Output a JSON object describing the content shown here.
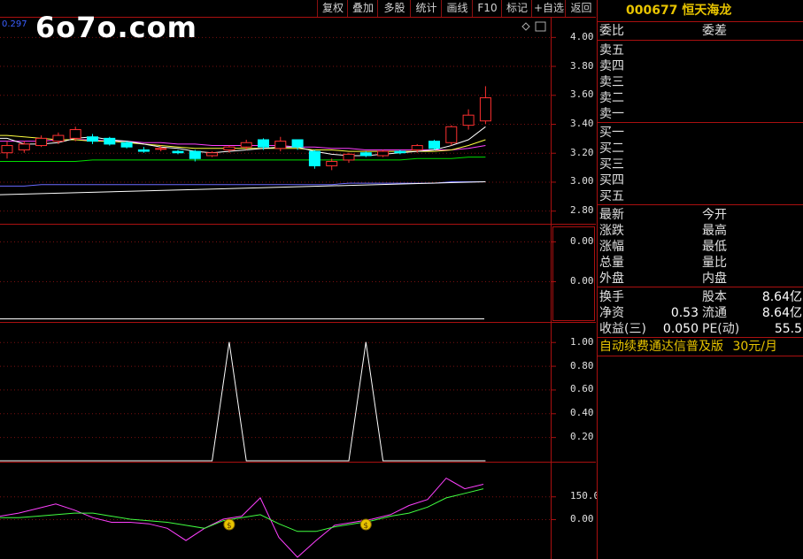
{
  "toolbar": {
    "buttons": [
      "复权",
      "叠加",
      "多股",
      "统计",
      "画线",
      "F10",
      "标记",
      "+自选",
      "返回"
    ]
  },
  "watermark": "6o7o.com",
  "main_value_label": "0.297",
  "stock": {
    "code": "000677",
    "name": "恒天海龙"
  },
  "order_book": {
    "header_left": "委比",
    "header_right": "委差",
    "sell": [
      "卖五",
      "卖四",
      "卖三",
      "卖二",
      "卖一"
    ],
    "buy": [
      "买一",
      "买二",
      "买三",
      "买四",
      "买五"
    ]
  },
  "quote": {
    "left": [
      "最新",
      "涨跌",
      "涨幅",
      "总量",
      "外盘"
    ],
    "right": [
      "今开",
      "最高",
      "最低",
      "量比",
      "内盘"
    ]
  },
  "fundamentals": [
    {
      "label": "换手",
      "value": "",
      "label2": "股本",
      "value2": "8.64亿"
    },
    {
      "label": "净资",
      "value": "0.53",
      "label2": "流通",
      "value2": "8.64亿"
    },
    {
      "label": "收益(三)",
      "value": "0.050",
      "label2": "PE(动)",
      "value2": "55.5"
    }
  ],
  "ad": {
    "text": "自动续费通达信普及版",
    "price": "30元/月"
  },
  "colors": {
    "border": "#aa1010",
    "up": "#ff3030",
    "down": "#00ffff",
    "stock_name": "#e8c400"
  },
  "chart_data": [
    {
      "type": "candlestick",
      "y_ticks": [
        "4.00",
        "3.80",
        "3.60",
        "3.40",
        "3.20",
        "3.00",
        "2.80"
      ],
      "ylim": [
        2.74,
        4.06
      ],
      "candles": [
        [
          3.2,
          3.25,
          3.16,
          3.28
        ],
        [
          3.22,
          3.26,
          3.2,
          3.28
        ],
        [
          3.25,
          3.3,
          3.24,
          3.32
        ],
        [
          3.28,
          3.32,
          3.26,
          3.34
        ],
        [
          3.3,
          3.36,
          3.28,
          3.38
        ],
        [
          3.31,
          3.28,
          3.26,
          3.33
        ],
        [
          3.3,
          3.26,
          3.25,
          3.31
        ],
        [
          3.27,
          3.24,
          3.23,
          3.28
        ],
        [
          3.22,
          3.21,
          3.2,
          3.24
        ],
        [
          3.23,
          3.23,
          3.21,
          3.25
        ],
        [
          3.21,
          3.2,
          3.19,
          3.22
        ],
        [
          3.21,
          3.16,
          3.14,
          3.22
        ],
        [
          3.18,
          3.2,
          3.17,
          3.21
        ],
        [
          3.22,
          3.24,
          3.2,
          3.25
        ],
        [
          3.24,
          3.27,
          3.22,
          3.29
        ],
        [
          3.29,
          3.24,
          3.22,
          3.3
        ],
        [
          3.23,
          3.28,
          3.21,
          3.31
        ],
        [
          3.29,
          3.24,
          3.22,
          3.29
        ],
        [
          3.21,
          3.11,
          3.09,
          3.22
        ],
        [
          3.11,
          3.14,
          3.08,
          3.16
        ],
        [
          3.15,
          3.19,
          3.13,
          3.2
        ],
        [
          3.2,
          3.18,
          3.17,
          3.21
        ],
        [
          3.18,
          3.21,
          3.17,
          3.22
        ],
        [
          3.21,
          3.2,
          3.19,
          3.22
        ],
        [
          3.22,
          3.25,
          3.2,
          3.26
        ],
        [
          3.28,
          3.23,
          3.22,
          3.29
        ],
        [
          3.27,
          3.38,
          3.25,
          3.39
        ],
        [
          3.39,
          3.46,
          3.36,
          3.5
        ],
        [
          3.42,
          3.58,
          3.4,
          3.66
        ]
      ],
      "ma_white": [
        3.3,
        3.26,
        3.26,
        3.27,
        3.3,
        3.31,
        3.29,
        3.28,
        3.26,
        3.24,
        3.23,
        3.21,
        3.2,
        3.21,
        3.22,
        3.23,
        3.24,
        3.24,
        3.21,
        3.19,
        3.18,
        3.18,
        3.19,
        3.2,
        3.21,
        3.22,
        3.25,
        3.29,
        3.38
      ],
      "ma_yellow": [
        3.32,
        3.31,
        3.3,
        3.29,
        3.29,
        3.28,
        3.28,
        3.27,
        3.26,
        3.25,
        3.24,
        3.23,
        3.23,
        3.23,
        3.23,
        3.23,
        3.23,
        3.23,
        3.22,
        3.22,
        3.21,
        3.21,
        3.21,
        3.21,
        3.21,
        3.21,
        3.22,
        3.25,
        3.29
      ],
      "ma_magenta": [
        3.28,
        3.28,
        3.28,
        3.29,
        3.29,
        3.29,
        3.28,
        3.28,
        3.27,
        3.27,
        3.26,
        3.26,
        3.25,
        3.25,
        3.25,
        3.25,
        3.25,
        3.24,
        3.24,
        3.23,
        3.23,
        3.22,
        3.22,
        3.22,
        3.22,
        3.22,
        3.22,
        3.23,
        3.25
      ],
      "ma_green": [
        3.14,
        3.14,
        3.14,
        3.14,
        3.14,
        3.15,
        3.15,
        3.15,
        3.15,
        3.15,
        3.15,
        3.15,
        3.15,
        3.15,
        3.15,
        3.15,
        3.15,
        3.15,
        3.15,
        3.15,
        3.15,
        3.15,
        3.15,
        3.15,
        3.16,
        3.16,
        3.16,
        3.17,
        3.17
      ],
      "ma_blue": [
        2.97,
        2.97,
        2.98,
        2.98,
        2.98,
        2.98,
        2.98,
        2.98,
        2.98,
        2.98,
        2.98,
        2.98,
        2.98,
        2.98,
        2.98,
        2.98,
        2.98,
        2.98,
        2.98,
        2.98,
        2.99,
        2.99,
        2.99,
        2.99,
        2.99,
        2.99,
        3.0,
        3.0,
        3.0
      ]
    },
    {
      "type": "line",
      "y_ticks": [
        "0.00",
        "0.00"
      ],
      "values": [
        0,
        0,
        0,
        0,
        0,
        0,
        0,
        0,
        0,
        0,
        0,
        0,
        0,
        0,
        0,
        0,
        0,
        0,
        0,
        0,
        0,
        0,
        0,
        0,
        0,
        0,
        0,
        0,
        0
      ]
    },
    {
      "type": "line",
      "y_ticks": [
        "1.00",
        "0.80",
        "0.60",
        "0.40",
        "0.20"
      ],
      "ylim": [
        0,
        1.05
      ],
      "values": [
        0,
        0,
        0,
        0,
        0,
        0,
        0,
        0,
        0,
        0,
        0,
        0,
        0,
        1,
        0,
        0,
        0,
        0,
        0,
        0,
        0,
        1,
        0,
        0,
        0,
        0,
        0,
        0,
        0
      ]
    },
    {
      "type": "line",
      "y_ticks": [
        "150.0",
        "0.00"
      ],
      "ylim": [
        -250,
        320
      ],
      "series": [
        {
          "values": [
            20,
            40,
            70,
            100,
            60,
            10,
            -20,
            -20,
            -30,
            -60,
            -140,
            -60,
            0,
            20,
            140,
            -120,
            -250,
            -140,
            -40,
            -20,
            0,
            30,
            90,
            130,
            270,
            200,
            230
          ]
        },
        {
          "values": [
            10,
            10,
            20,
            30,
            40,
            40,
            20,
            0,
            -10,
            -20,
            -40,
            -60,
            -10,
            10,
            30,
            -30,
            -80,
            -80,
            -50,
            -30,
            -10,
            20,
            40,
            80,
            140,
            170,
            200
          ]
        }
      ],
      "signals": [
        13,
        21
      ]
    }
  ]
}
